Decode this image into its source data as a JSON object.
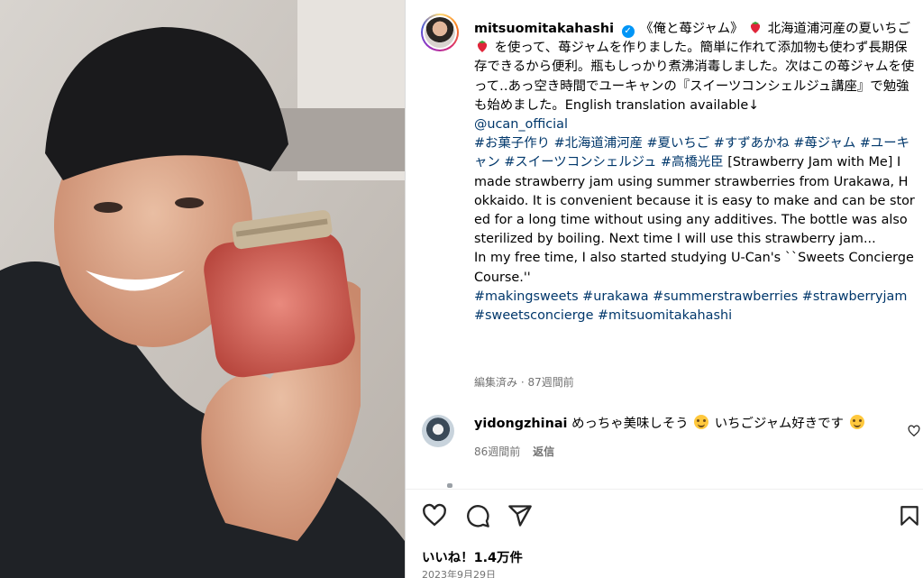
{
  "post": {
    "username": "mitsuomitakahashi",
    "caption_title": "《俺と苺ジャム》",
    "caption_line1": "北海道浦河産の夏いち",
    "caption_line2": "ご",
    "caption_body_jp": "を使って、苺ジャムを作りました。簡単に作れて添加物も使わず長期保存できるから便利。瓶もしっかり煮沸消毒しました。次はこの苺ジャムを使って‥あっ空き時間でユーキャンの『スイーツコンシェルジュ講座』で勉強も始めました。English translation available↓",
    "mention": "@ucan_official",
    "hashtags_jp": "#お菓子作り #北海道浦河産 #夏いちご #すずあかね #苺ジャム #ユーキャン #スイーツコンシェルジュ #高橋光臣",
    "caption_body_en": "[Strawberry Jam with Me] I made strawberry jam using summer strawberries from Urakawa, Hokkaido. It is convenient because it is easy to make and can be stored for a long time without using any additives. The bottle was also sterilized by boiling. Next time I will use this strawberry jam...",
    "caption_body_en2": "In my free time, I also started studying U-Can's ``Sweets Concierge Course.''",
    "hashtags_en": "#makingsweets #urakawa #summerstrawberries #strawberryjam #sweetsconcierge #mitsuomitakahashi",
    "edited_meta": "編集済み · 87週間前"
  },
  "comment": {
    "username": "yidongzhinai",
    "text_a": "めっちゃ美味しそう",
    "text_b": "いちごジャム好きです",
    "age": "86週間前",
    "reply_label": "返信"
  },
  "footer": {
    "likes": "いいね！1.4万件",
    "date": "2023年9月29日"
  },
  "icons": {
    "verified": "verified-badge-icon",
    "heart": "heart-icon",
    "comment": "comment-icon",
    "share": "send-icon",
    "save": "bookmark-icon"
  },
  "colors": {
    "link": "#00376b",
    "verified": "#0095f6",
    "muted": "#737373"
  }
}
